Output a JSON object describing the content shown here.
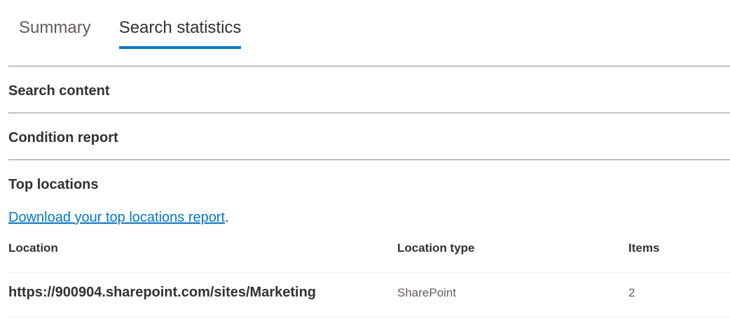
{
  "tabs": [
    {
      "label": "Summary",
      "active": false
    },
    {
      "label": "Search statistics",
      "active": true
    }
  ],
  "sections": {
    "search_content": "Search content",
    "condition_report": "Condition report",
    "top_locations": "Top locations"
  },
  "download": {
    "link_text": " Download your top locations report",
    "suffix": "."
  },
  "table": {
    "headers": {
      "location": "Location",
      "location_type": "Location type",
      "items": "Items"
    },
    "rows": [
      {
        "location": "https://900904.sharepoint.com/sites/Marketing",
        "location_type": "SharePoint",
        "items": "2"
      }
    ]
  },
  "colors": {
    "accent": "#0078d4",
    "text": "#323130",
    "muted": "#605e5c",
    "divider": "#8a8886"
  }
}
